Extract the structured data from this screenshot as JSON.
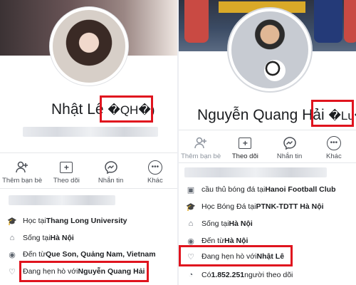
{
  "left": {
    "name": "Nhật Lê",
    "name_suffix": "�QH�)",
    "actions": [
      {
        "label": "Thêm bạn bè",
        "icon": "add-friend-icon"
      },
      {
        "label": "Theo dõi",
        "icon": "follow-icon"
      },
      {
        "label": "Nhắn tin",
        "icon": "messenger-icon"
      },
      {
        "label": "Khác",
        "icon": "more-icon"
      }
    ],
    "info": [
      {
        "icon": "education-icon",
        "prefix": "Học tại ",
        "value": "Thang Long University"
      },
      {
        "icon": "home-icon",
        "prefix": "Sống tại ",
        "value": "Hà Nội"
      },
      {
        "icon": "location-icon",
        "prefix": "Đến từ ",
        "value": "Que Son, Quảng Nam, Vietnam"
      },
      {
        "icon": "heart-icon",
        "prefix": "Đang hẹn hò với ",
        "value": "Nguyễn Quang Hải"
      }
    ]
  },
  "right": {
    "name": "Nguyễn Quang Hải",
    "name_suffix": "�Lu�)",
    "actions": [
      {
        "label": "Thêm bạn bè",
        "icon": "add-friend-icon"
      },
      {
        "label": "Theo dõi",
        "icon": "follow-icon"
      },
      {
        "label": "Nhắn tin",
        "icon": "messenger-icon"
      },
      {
        "label": "Khác",
        "icon": "more-icon"
      }
    ],
    "info": [
      {
        "icon": "work-icon",
        "prefix": "cầu thủ bóng đá tại ",
        "value": "Hanoi Football Club"
      },
      {
        "icon": "education-icon",
        "prefix": "Học Bóng Đá tại ",
        "value": "PTNK-TDTT Hà Nội"
      },
      {
        "icon": "home-icon",
        "prefix": "Sống tại ",
        "value": "Hà Nội"
      },
      {
        "icon": "location-icon",
        "prefix": "Đến từ ",
        "value": "Hà Nội"
      },
      {
        "icon": "heart-icon",
        "prefix": "Đang hẹn hò với ",
        "value": "Nhật Lê"
      },
      {
        "icon": "rss-icon",
        "prefix": "Có ",
        "value": "1.852.251",
        "suffix": " người theo dõi"
      }
    ]
  },
  "colors": {
    "highlight": "#e0141e",
    "verified": "#4a8bf5",
    "text": "#1c1e21",
    "muted": "#606770"
  }
}
